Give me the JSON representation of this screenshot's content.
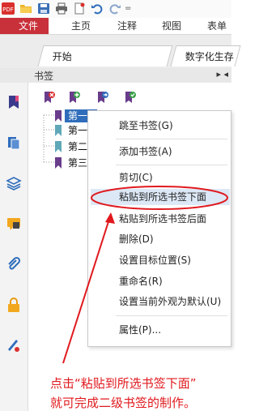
{
  "quick_access": {
    "icons": [
      "pdf-logo-icon",
      "open-folder-icon",
      "save-icon",
      "print-icon",
      "new-icon",
      "undo-icon",
      "redo-icon",
      "dropdown-icon"
    ],
    "dropdown_glyph": "="
  },
  "menubar": {
    "items": [
      "文件",
      "主页",
      "注释",
      "视图",
      "表单"
    ]
  },
  "tabs": [
    {
      "label": "开始"
    },
    {
      "label": "数字化生存"
    }
  ],
  "bookmark_panel": {
    "title": "书签",
    "arrows": "▸ ◂",
    "toolbar_icons": [
      "delete-bookmark-icon",
      "add-bookmark-icon",
      "add-child-bookmark-icon",
      "bookmark-properties-icon"
    ],
    "items": [
      {
        "label": "第一章",
        "selected": true
      },
      {
        "label": "第一节",
        "selected": false
      },
      {
        "label": "第二节",
        "selected": false
      },
      {
        "label": "第三章",
        "selected": false
      }
    ]
  },
  "sidebar": {
    "icons": [
      "bookmark-icon",
      "page-thumbnails-icon",
      "layers-icon",
      "comments-icon",
      "attachments-icon",
      "security-icon",
      "signature-icon"
    ]
  },
  "context_menu": {
    "items": [
      {
        "label": "跳至书签(G)"
      },
      {
        "label": "添加书签(A)"
      },
      {
        "label": "剪切(C)"
      },
      {
        "label": "粘贴到所选书签下面",
        "highlighted": true
      },
      {
        "label": "粘贴到所选书签后面"
      },
      {
        "label": "删除(D)"
      },
      {
        "label": "设置目标位置(S)"
      },
      {
        "label": "重命名(R)"
      },
      {
        "label": "设置当前外观为默认(U)"
      },
      {
        "label": "属性(P)..."
      }
    ]
  },
  "annotation": {
    "line1": "点击“粘贴到所选书签下面”",
    "line2": "就可完成二级书签的制作。",
    "color": "#e0191e"
  }
}
